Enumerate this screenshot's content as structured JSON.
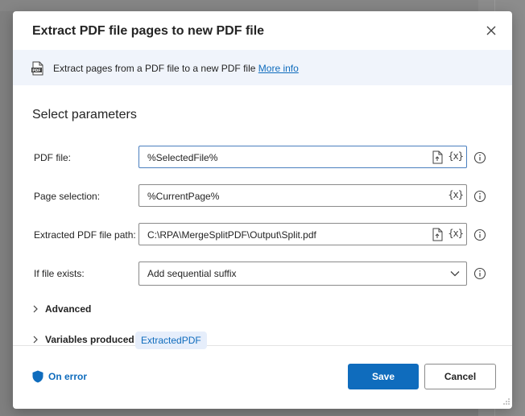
{
  "dialog": {
    "title": "Extract PDF file pages to new PDF file",
    "close_icon": "close-icon"
  },
  "banner": {
    "icon": "pdf-icon",
    "description": "Extract pages from a PDF file to a new PDF file",
    "more_info": "More info"
  },
  "params": {
    "section_title": "Select parameters",
    "pdf_file": {
      "label": "PDF file:",
      "value": "%SelectedFile%"
    },
    "page_selection": {
      "label": "Page selection:",
      "value": "%CurrentPage%"
    },
    "output_path": {
      "label": "Extracted PDF file path:",
      "value": "C:\\RPA\\MergeSplitPDF\\Output\\Split.pdf"
    },
    "if_exists": {
      "label": "If file exists:",
      "value": "Add sequential suffix"
    },
    "variable_icon_text": "{x}"
  },
  "advanced": {
    "label": "Advanced"
  },
  "variables": {
    "label": "Variables produced",
    "chip": "ExtractedPDF"
  },
  "footer": {
    "on_error": "On error",
    "save": "Save",
    "cancel": "Cancel"
  },
  "colors": {
    "accent": "#0f6cbd",
    "banner_bg": "#f0f4fb",
    "chip_bg": "#e6eefb"
  }
}
